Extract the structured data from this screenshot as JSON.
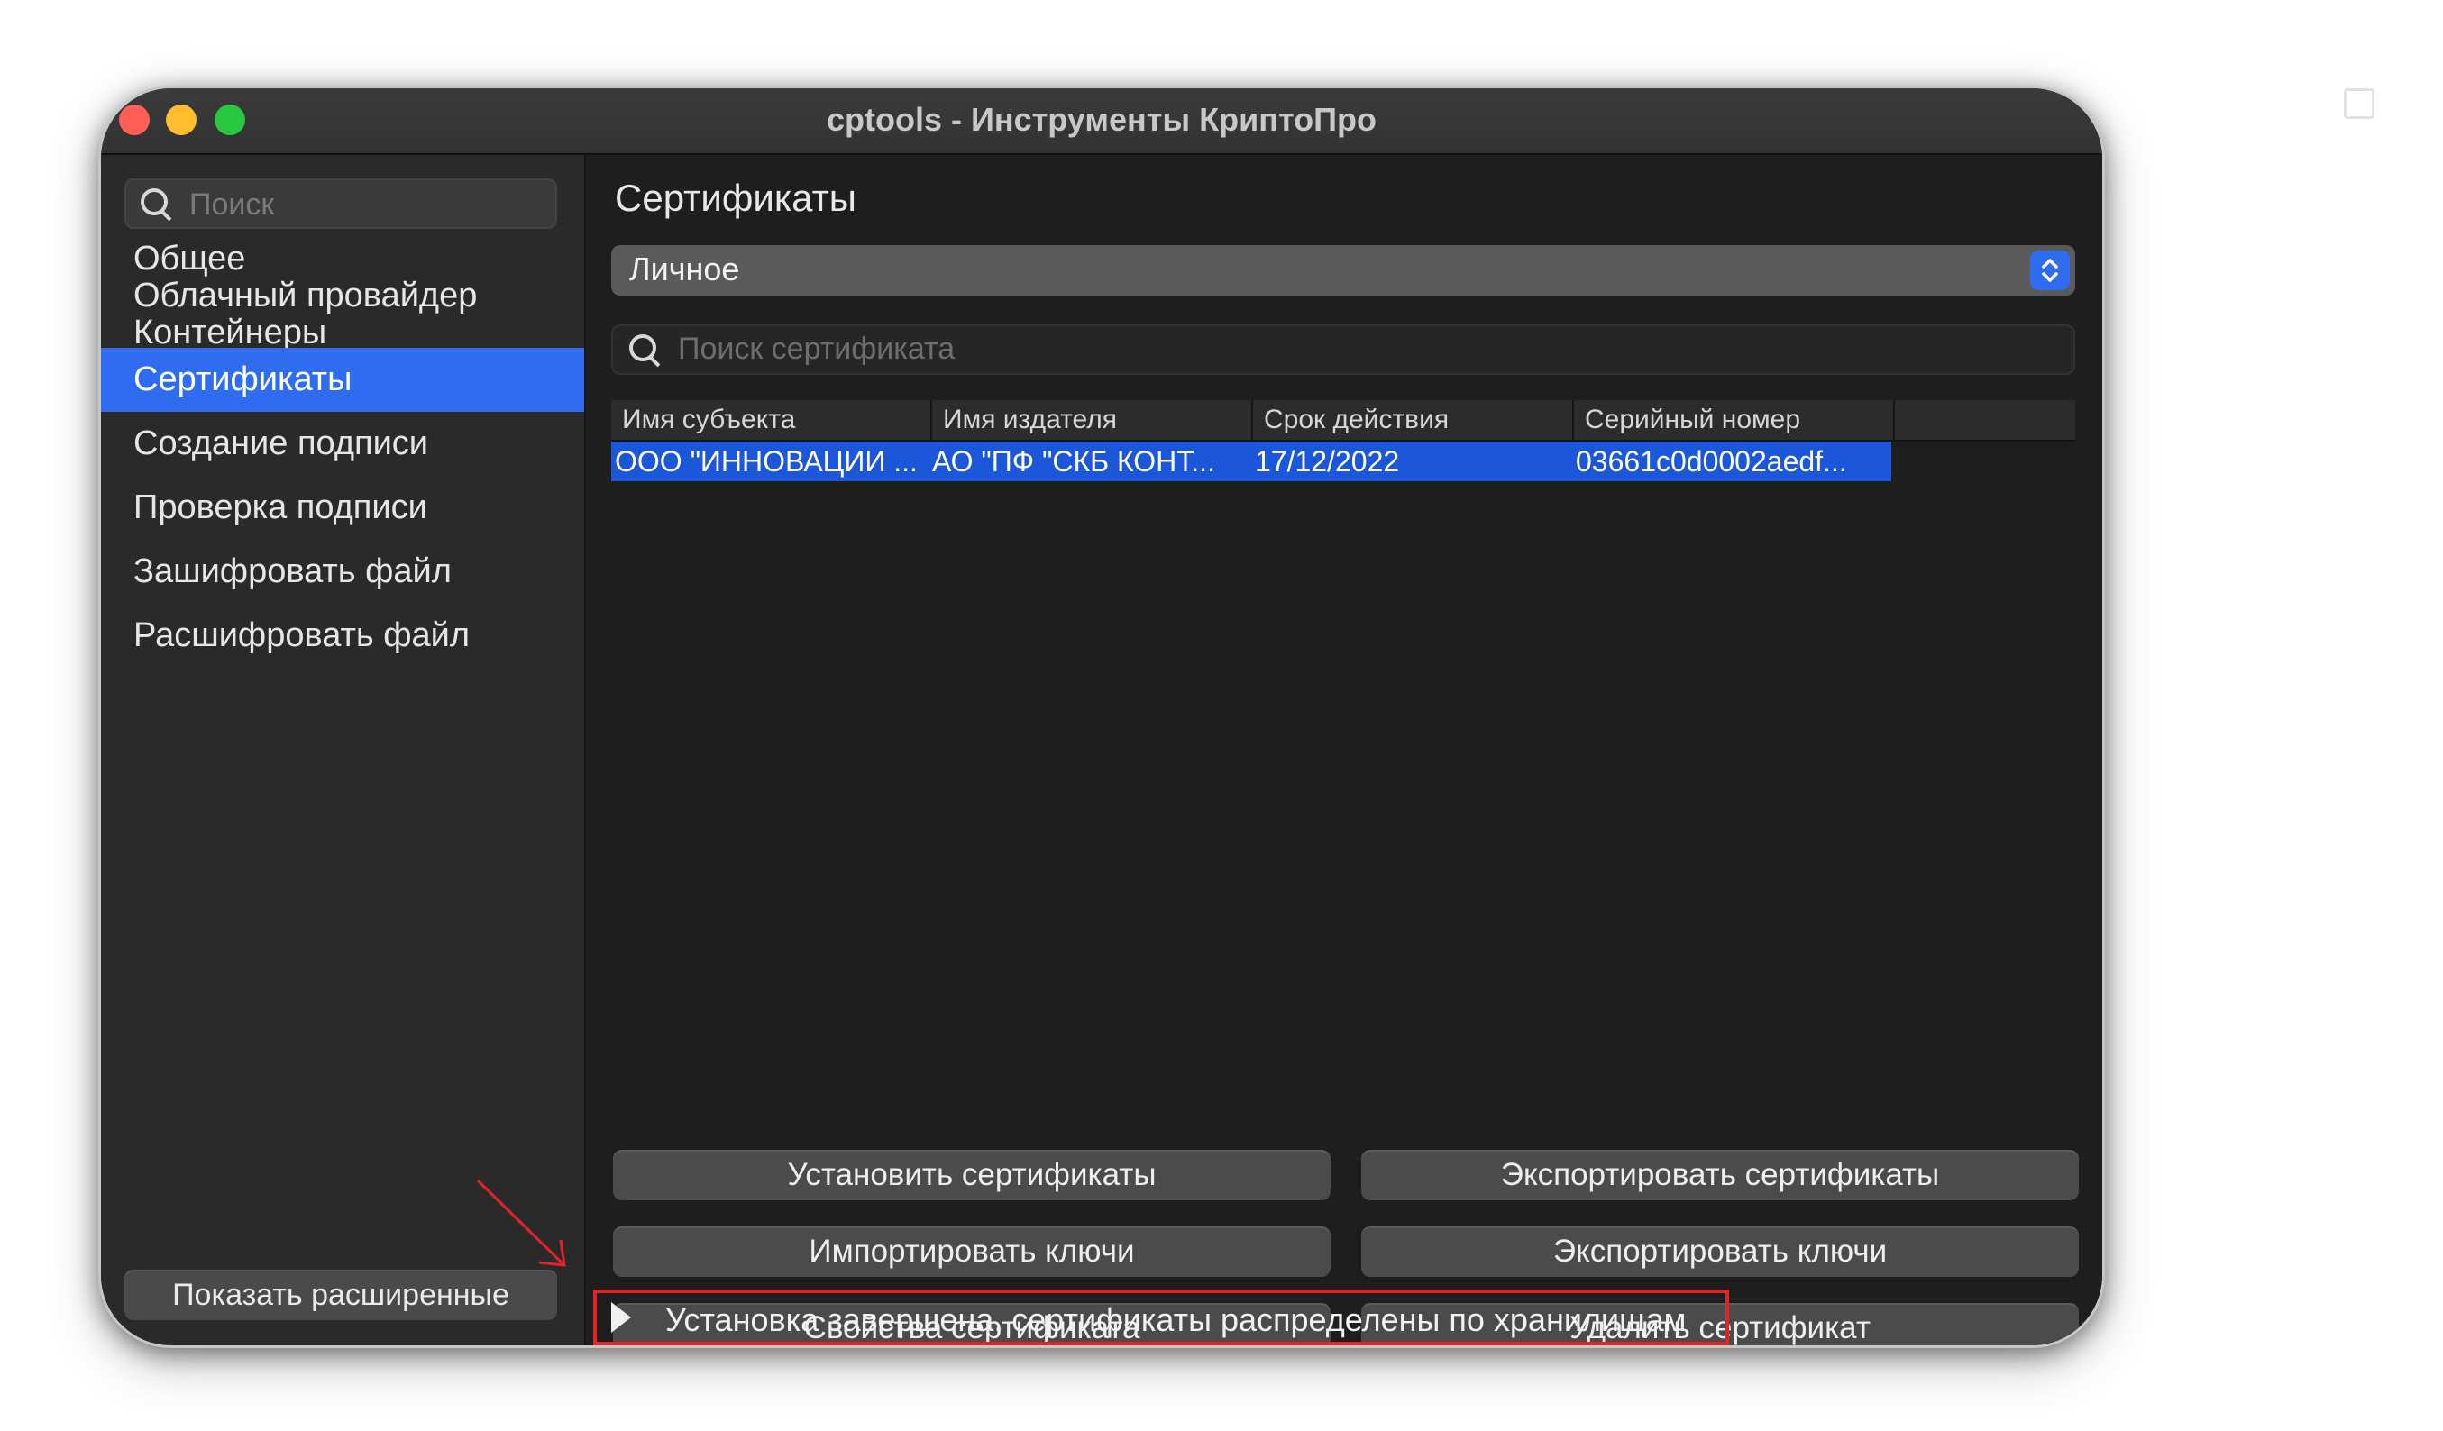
{
  "window": {
    "title": "cptools - Инструменты КриптоПро"
  },
  "sidebar": {
    "search_placeholder": "Поиск",
    "items": [
      {
        "label": "Общее"
      },
      {
        "label": "Облачный провайдер"
      },
      {
        "label": "Контейнеры"
      },
      {
        "label": "Сертификаты",
        "active": true
      },
      {
        "label": "Создание подписи"
      },
      {
        "label": "Проверка подписи"
      },
      {
        "label": "Зашифровать файл"
      },
      {
        "label": "Расшифровать файл"
      }
    ],
    "advanced_button": "Показать расширенные"
  },
  "main": {
    "title": "Сертификаты",
    "store_select": "Личное",
    "search_placeholder": "Поиск сертификата",
    "table": {
      "columns": [
        "Имя субъекта",
        "Имя издателя",
        "Срок действия",
        "Серийный номер"
      ],
      "rows": [
        [
          "ООО \"ИННОВАЦИИ ...",
          "АО \"ПФ \"СКБ КОНТ...",
          "17/12/2022",
          "03661c0d0002aedf..."
        ]
      ]
    },
    "buttons": {
      "install_certs": "Установить сертификаты",
      "export_certs": "Экспортировать сертификаты",
      "import_keys": "Импортировать ключи",
      "export_keys": "Экспортировать ключи",
      "cert_properties": "Свойства сертификата",
      "delete_cert": "Удалить сертификат"
    },
    "status_message": "Установка завершена, сертификаты распределены по хранилищам"
  },
  "colors": {
    "accent": "#2f6cf0",
    "selection": "#1c57d9",
    "annotation_red": "#e3232a"
  }
}
